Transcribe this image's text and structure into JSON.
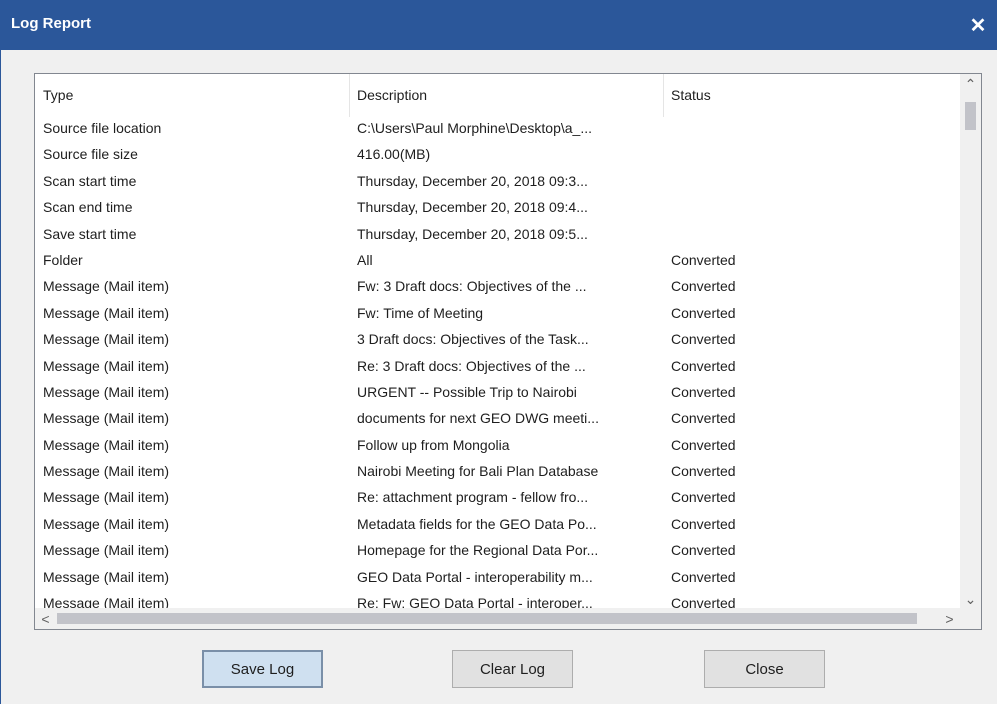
{
  "window": {
    "title": "Log Report",
    "close_glyph": "✕"
  },
  "colors": {
    "titlebar": "#2b579a",
    "panel": "#f0f0f0",
    "list_bg": "#ffffff"
  },
  "columns": {
    "type": "Type",
    "description": "Description",
    "status": "Status"
  },
  "rows": [
    {
      "type": "Source file location",
      "description": "C:\\Users\\Paul Morphine\\Desktop\\a_...",
      "status": ""
    },
    {
      "type": "Source file size",
      "description": "416.00(MB)",
      "status": ""
    },
    {
      "type": "Scan start time",
      "description": "Thursday, December 20, 2018 09:3...",
      "status": ""
    },
    {
      "type": "Scan end time",
      "description": "Thursday, December 20, 2018 09:4...",
      "status": ""
    },
    {
      "type": "Save start time",
      "description": "Thursday, December 20, 2018 09:5...",
      "status": ""
    },
    {
      "type": "Folder",
      "description": "All",
      "status": "Converted"
    },
    {
      "type": "Message (Mail item)",
      "description": "Fw: 3 Draft docs: Objectives of the ...",
      "status": "Converted"
    },
    {
      "type": "Message (Mail item)",
      "description": "Fw: Time of Meeting",
      "status": "Converted"
    },
    {
      "type": "Message (Mail item)",
      "description": "3 Draft docs: Objectives of the Task...",
      "status": "Converted"
    },
    {
      "type": "Message (Mail item)",
      "description": "Re: 3 Draft docs: Objectives of the ...",
      "status": "Converted"
    },
    {
      "type": "Message (Mail item)",
      "description": "URGENT  --  Possible Trip to Nairobi",
      "status": "Converted"
    },
    {
      "type": "Message (Mail item)",
      "description": "documents for next GEO DWG meeti...",
      "status": "Converted"
    },
    {
      "type": "Message (Mail item)",
      "description": "Follow up from Mongolia",
      "status": "Converted"
    },
    {
      "type": "Message (Mail item)",
      "description": "Nairobi Meeting for Bali Plan Database",
      "status": "Converted"
    },
    {
      "type": "Message (Mail item)",
      "description": "Re: attachment program - fellow fro...",
      "status": "Converted"
    },
    {
      "type": "Message (Mail item)",
      "description": "Metadata fields for the GEO Data Po...",
      "status": "Converted"
    },
    {
      "type": "Message (Mail item)",
      "description": "Homepage for the Regional Data Por...",
      "status": "Converted"
    },
    {
      "type": "Message (Mail item)",
      "description": "GEO Data Portal - interoperability m...",
      "status": "Converted"
    },
    {
      "type": "Message (Mail item)",
      "description": "Re: Fw: GEO Data Portal - interoper...",
      "status": "Converted"
    }
  ],
  "scroll": {
    "up_glyph": "⌃",
    "down_glyph": "⌄",
    "left_glyph": "<",
    "right_glyph": ">"
  },
  "buttons": {
    "save": "Save Log",
    "clear": "Clear Log",
    "close": "Close"
  }
}
